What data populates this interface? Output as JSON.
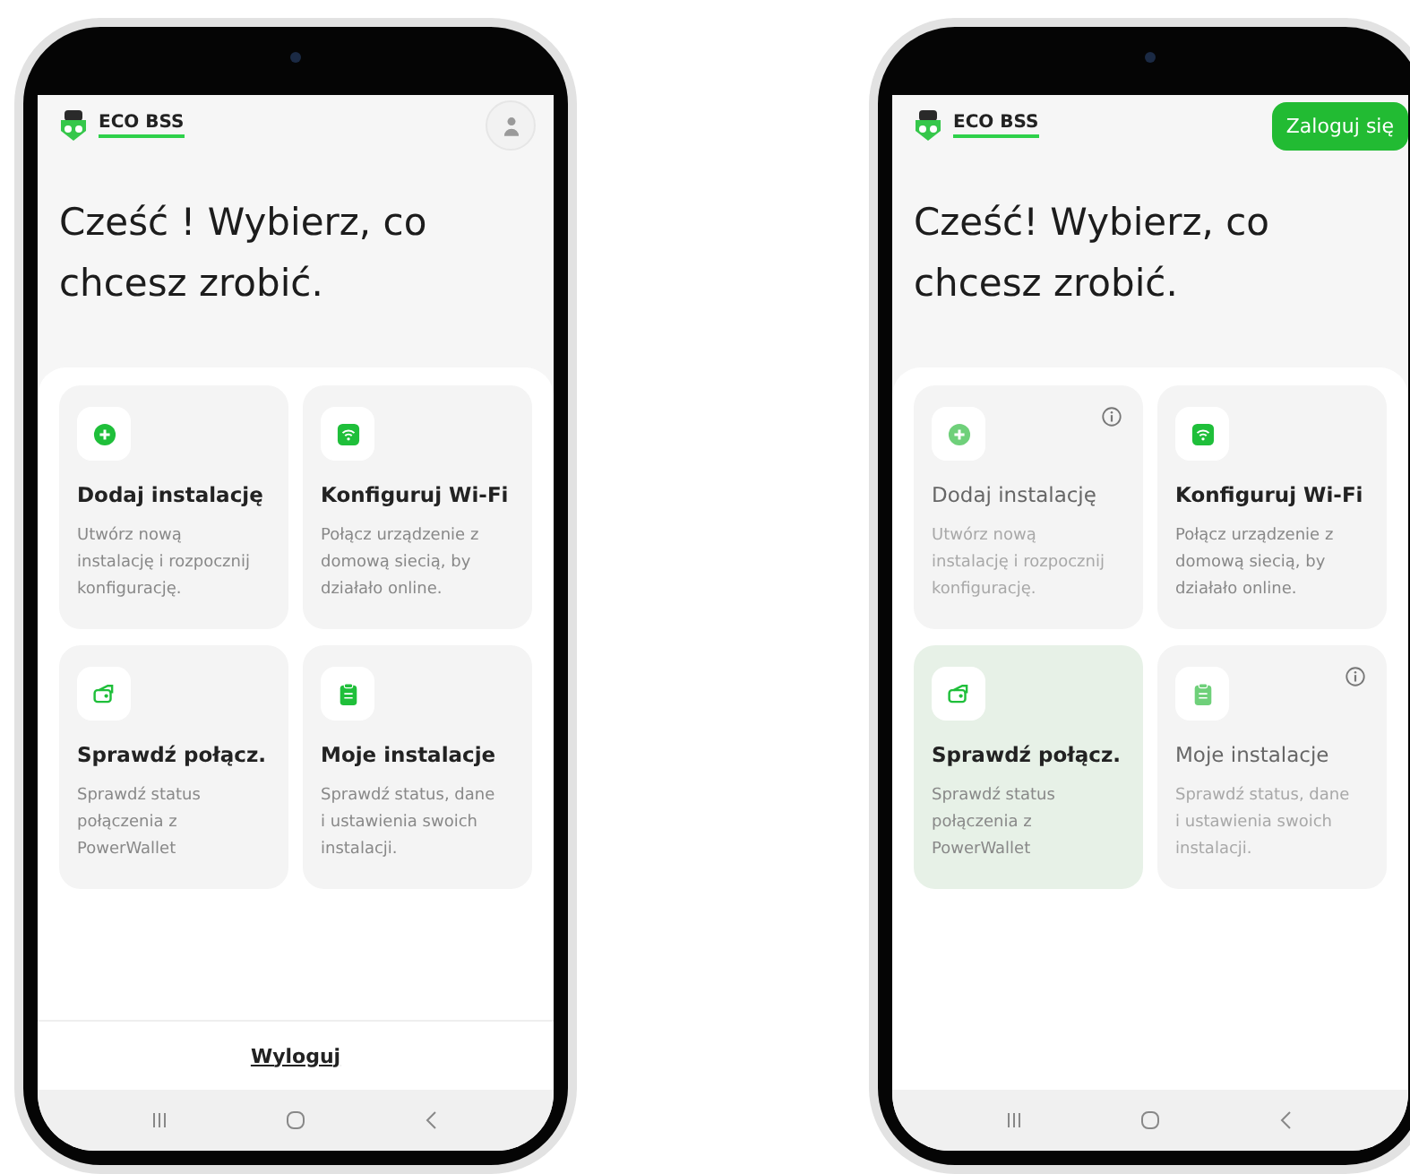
{
  "phones": [
    {
      "header": {
        "brand": "ECO BSS",
        "action": {
          "kind": "avatar"
        }
      },
      "title": "Cześć ! Wybierz, co chcesz zrobić.",
      "cards": [
        {
          "kind": "plus",
          "title": "Dodaj instalację",
          "description": "Utwórz nową instalację i rozpocznij konfigurację.",
          "disabled": false,
          "selected": false
        },
        {
          "kind": "wifi",
          "title": "Konfiguruj Wi-Fi",
          "description": "Połącz urządzenie z domową siecią, by działało online.",
          "disabled": false,
          "selected": false
        },
        {
          "kind": "wallet",
          "title": "Sprawdź połącz.",
          "description": "Sprawdź status połączenia z PowerWallet",
          "disabled": false,
          "selected": false
        },
        {
          "kind": "clipboard",
          "title": "Moje instalacje",
          "description": "Sprawdź status, dane i ustawienia swoich instalacji.",
          "disabled": false,
          "selected": false
        }
      ],
      "footer": {
        "link": "Wyloguj"
      }
    },
    {
      "header": {
        "brand": "ECO BSS",
        "action": {
          "kind": "button",
          "label": "Zaloguj się"
        }
      },
      "title": "Cześć! Wybierz, co chcesz zrobić.",
      "cards": [
        {
          "kind": "plus",
          "title": "Dodaj instalację",
          "description": "Utwórz nową instalację i rozpocznij konfigurację.",
          "disabled": true,
          "selected": false
        },
        {
          "kind": "wifi",
          "title": "Konfiguruj Wi-Fi",
          "description": "Połącz urządzenie z domową siecią, by działało online.",
          "disabled": false,
          "selected": false
        },
        {
          "kind": "wallet",
          "title": "Sprawdź połącz.",
          "description": "Sprawdź status połączenia z PowerWallet",
          "disabled": false,
          "selected": true
        },
        {
          "kind": "clipboard",
          "title": "Moje instalacje",
          "description": "Sprawdź status, dane i ustawienia swoich instalacji.",
          "disabled": true,
          "selected": false
        }
      ]
    }
  ]
}
